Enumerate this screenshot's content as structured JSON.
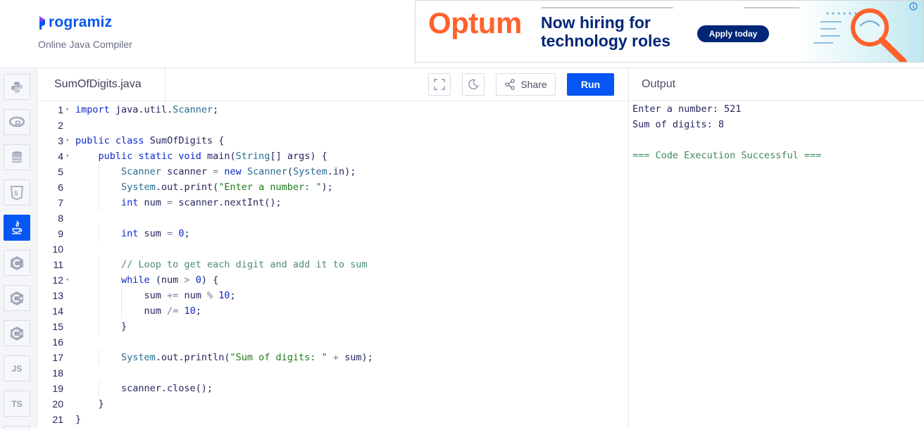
{
  "header": {
    "logo_text": "rogramiz",
    "subtitle": "Online Java Compiler"
  },
  "ad": {
    "brand": "Optum",
    "headline_line1": "Now hiring for",
    "headline_line2": "technology roles",
    "cta": "Apply today",
    "info_icon": "info-icon",
    "art_icon": "magnifier-icon"
  },
  "languages": [
    {
      "name": "python",
      "label": "",
      "icon": "python-icon",
      "active": false
    },
    {
      "name": "r",
      "label": "R",
      "icon": "r-icon",
      "active": false
    },
    {
      "name": "sql",
      "label": "",
      "icon": "database-icon",
      "active": false
    },
    {
      "name": "html",
      "label": "5",
      "icon": "html5-icon",
      "active": false
    },
    {
      "name": "java",
      "label": "",
      "icon": "java-icon",
      "active": true
    },
    {
      "name": "c",
      "label": "C",
      "icon": "c-icon",
      "active": false
    },
    {
      "name": "cpp",
      "label": "C",
      "icon": "cpp-icon",
      "active": false
    },
    {
      "name": "csharp",
      "label": "C",
      "icon": "csharp-icon",
      "active": false
    },
    {
      "name": "javascript",
      "label": "JS",
      "icon": "js-icon",
      "active": false
    },
    {
      "name": "typescript",
      "label": "TS",
      "icon": "ts-icon",
      "active": false
    }
  ],
  "editor": {
    "file_name": "SumOfDigits.java",
    "share_label": "Share",
    "run_label": "Run",
    "fullscreen_icon": "fullscreen-icon",
    "theme_icon": "moon-icon",
    "share_icon": "share-icon"
  },
  "code_lines": [
    "import java.util.Scanner;",
    "",
    "public class SumOfDigits {",
    "    public static void main(String[] args) {",
    "        Scanner scanner = new Scanner(System.in);",
    "        System.out.print(\"Enter a number: \");",
    "        int num = scanner.nextInt();",
    "",
    "        int sum = 0;",
    "",
    "        // Loop to get each digit and add it to sum",
    "        while (num > 0) {",
    "            sum += num % 10;",
    "            num /= 10;",
    "        }",
    "",
    "        System.out.println(\"Sum of digits: \" + sum);",
    "",
    "        scanner.close();",
    "    }",
    "}"
  ],
  "fold_lines": [
    1,
    3,
    4,
    12
  ],
  "output": {
    "title": "Output",
    "lines": [
      "Enter a number: 521",
      "Sum of digits: 8",
      "",
      "=== Code Execution Successful ==="
    ]
  },
  "colors": {
    "accent": "#0556f3",
    "ad_brand": "#ff612b",
    "ad_navy": "#002677"
  }
}
